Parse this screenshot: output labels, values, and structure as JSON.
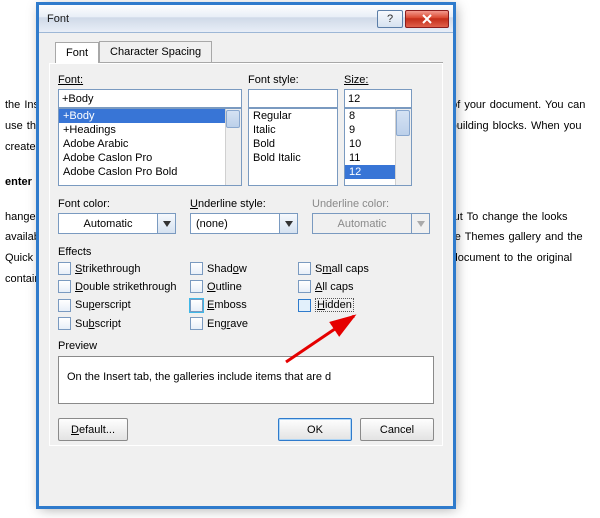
{
  "background_paragraphs": [
    "the Insert tab, the galleries include items that are designed to coordinate with the overall of your document. You can use these galleries to insert tables, headers, footers, lists, cover es, and other document building blocks. When you create pictures, charts, or diagrams, they coordinate with your current document look.",
    "enter your own text",
    "hange the overall look of your document, choose new Theme elements on the Page Layout To change the looks available in the Quick Style gallery, use the Change Current Quick Style ommand. Both the Themes gallery and the Quick Styles gallery provide reset commands so you can always restore the look of your document to the original contained in your current plate."
  ],
  "dialog": {
    "title": "Font",
    "tabs": [
      {
        "label": "Font",
        "active": true,
        "name": "tab-font"
      },
      {
        "label": "Character Spacing",
        "active": false,
        "name": "tab-character-spacing"
      }
    ]
  },
  "font_section": {
    "label": "Font:",
    "value": "+Body",
    "options": [
      "+Body",
      "+Headings",
      "Adobe Arabic",
      "Adobe Caslon Pro",
      "Adobe Caslon Pro Bold"
    ]
  },
  "style_section": {
    "label": "Font style:",
    "value": "",
    "options": [
      "Regular",
      "Italic",
      "Bold",
      "Bold Italic"
    ]
  },
  "size_section": {
    "label": "Size:",
    "value": "12",
    "options": [
      "8",
      "9",
      "10",
      "11",
      "12"
    ]
  },
  "dropdowns": {
    "font_color": {
      "label": "Font color:",
      "value": "Automatic"
    },
    "underline_style": {
      "label": "Underline style:",
      "value": "(none)"
    },
    "underline_color": {
      "label": "Underline color:",
      "value": "Automatic"
    }
  },
  "effects": {
    "title": "Effects",
    "items": [
      {
        "name": "strikethrough",
        "label": "Strikethrough",
        "accel": 0
      },
      {
        "name": "shadow",
        "label": "Shadow",
        "accel": 4
      },
      {
        "name": "small-caps",
        "label": "Small caps",
        "accel": 1
      },
      {
        "name": "double-strikethrough",
        "label": "Double strikethrough",
        "accel": 0
      },
      {
        "name": "outline",
        "label": "Outline",
        "accel": 0
      },
      {
        "name": "all-caps",
        "label": "All caps",
        "accel": 0
      },
      {
        "name": "superscript",
        "label": "Superscript",
        "accel": 2
      },
      {
        "name": "emboss",
        "label": "Emboss",
        "accel": 0
      },
      {
        "name": "hidden",
        "label": "Hidden",
        "accel": 0
      },
      {
        "name": "subscript",
        "label": "Subscript",
        "accel": 2
      },
      {
        "name": "engrave",
        "label": "Engrave",
        "accel": 3
      }
    ]
  },
  "preview": {
    "label": "Preview",
    "text": "On the Insert tab, the galleries include items that are d"
  },
  "buttons": {
    "default": "Default...",
    "ok": "OK",
    "cancel": "Cancel"
  }
}
